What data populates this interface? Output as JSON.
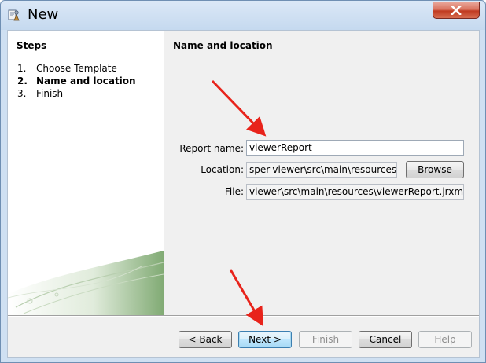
{
  "window": {
    "title": "New",
    "app_icon": "report-wizard-icon",
    "close_icon": "close-icon"
  },
  "steps": {
    "heading": "Steps",
    "items": [
      {
        "number": "1.",
        "label": "Choose Template",
        "active": false
      },
      {
        "number": "2.",
        "label": "Name and location",
        "active": true
      },
      {
        "number": "3.",
        "label": "Finish",
        "active": false
      }
    ]
  },
  "main": {
    "heading": "Name and location",
    "report_name": {
      "label": "Report name:",
      "value": "viewerReport"
    },
    "location": {
      "label": "Location:",
      "value": "sper-viewer\\src\\main\\resources",
      "browse_label": "Browse"
    },
    "file": {
      "label": "File:",
      "value": "viewer\\src\\main\\resources\\viewerReport.jrxml"
    }
  },
  "footer": {
    "back_label": "< Back",
    "next_label": "Next >",
    "finish_label": "Finish",
    "cancel_label": "Cancel",
    "help_label": "Help"
  },
  "colors": {
    "annotation_arrow": "#e8231b",
    "close_button": "#c9452c",
    "accent": "#3c7fb1"
  }
}
